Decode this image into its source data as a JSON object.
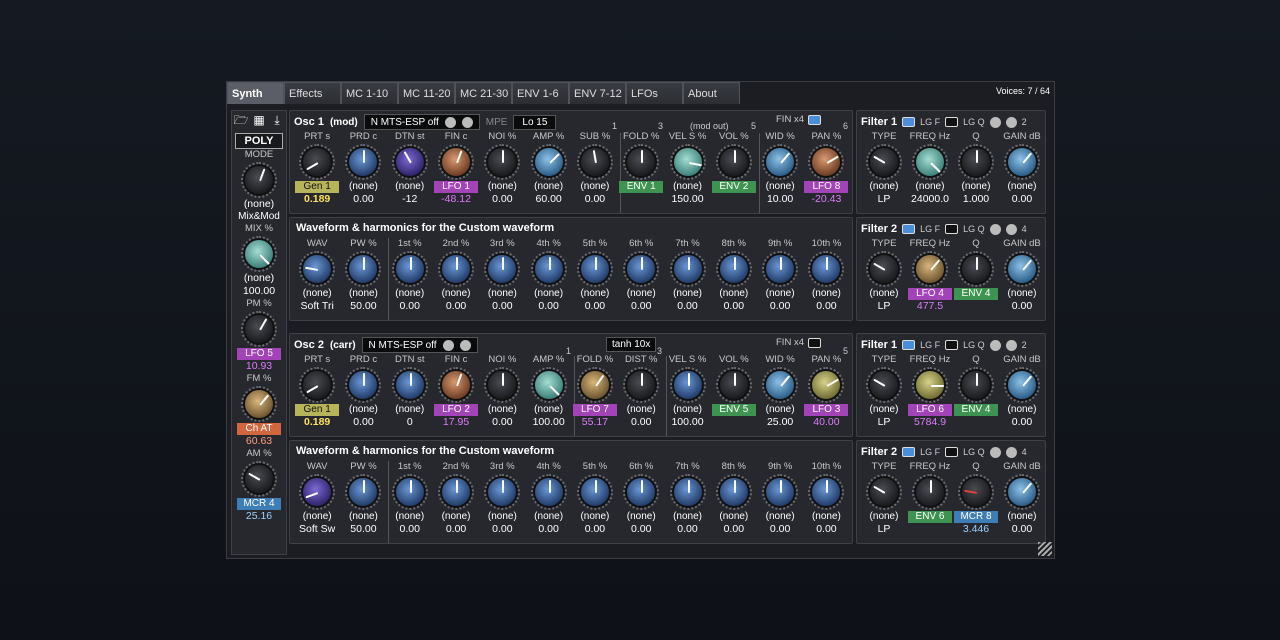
{
  "tabs": [
    "Synth",
    "Effects",
    "MC 1-10",
    "MC 11-20",
    "MC 21-30",
    "ENV 1-6",
    "ENV 7-12",
    "LFOs",
    "About"
  ],
  "voices": "Voices: 7 / 64",
  "left": {
    "poly": "POLY",
    "mode_label": "MODE",
    "mode_mod": "(none)",
    "mixmod": "Mix&Mod",
    "mix_label": "MIX %",
    "mix_mod": "(none)",
    "mix_val": "100.00",
    "pm_label": "PM %",
    "pm_mod": "LFO 5",
    "pm_val": "10.93",
    "fm_label": "FM %",
    "fm_mod": "Ch AT",
    "fm_val": "60.63",
    "am_label": "AM %",
    "am_mod": "MCR 4",
    "am_val": "25.16"
  },
  "osc1": {
    "title": "Osc 1",
    "sub": "(mod)",
    "mts": "N MTS-ESP off",
    "mpe": "MPE",
    "lo": "Lo 15",
    "n1": "1",
    "n3": "3",
    "modout": "(mod out)",
    "n5": "5",
    "n6": "6",
    "fin": "FIN x4",
    "labels": [
      "PRT s",
      "PRD c",
      "DTN st",
      "FIN c",
      "NOI %",
      "AMP %",
      "SUB %",
      "FOLD %",
      "VEL S %",
      "VOL %",
      "WID %",
      "PAN %"
    ],
    "mods": [
      "Gen 1",
      "(none)",
      "(none)",
      "LFO 1",
      "(none)",
      "(none)",
      "(none)",
      "ENV 1",
      "(none)",
      "ENV 2",
      "(none)",
      "LFO 8"
    ],
    "vals": [
      "0.189",
      "0.00",
      "-12",
      "-48.12",
      "0.00",
      "60.00",
      "0.00",
      "",
      "150.00",
      "",
      "10.00",
      "-20.43"
    ]
  },
  "wave1": {
    "title": "Waveform & harmonics for the Custom waveform",
    "labels": [
      "WAV",
      "PW %",
      "1st %",
      "2nd %",
      "3rd %",
      "4th %",
      "5th %",
      "6th %",
      "7th %",
      "8th %",
      "9th %",
      "10th %"
    ],
    "mods": [
      "(none)",
      "(none)",
      "(none)",
      "(none)",
      "(none)",
      "(none)",
      "(none)",
      "(none)",
      "(none)",
      "(none)",
      "(none)",
      "(none)"
    ],
    "vals": [
      "Soft Tri",
      "50.00",
      "0.00",
      "0.00",
      "0.00",
      "0.00",
      "0.00",
      "0.00",
      "0.00",
      "0.00",
      "0.00",
      "0.00"
    ]
  },
  "osc2": {
    "title": "Osc 2",
    "sub": "(carr)",
    "mts": "N MTS-ESP off",
    "tanh": "tanh 10x",
    "n1": "1",
    "n3": "3",
    "n5": "5",
    "fin": "FIN x4",
    "labels": [
      "PRT s",
      "PRD c",
      "DTN st",
      "FIN c",
      "NOI %",
      "AMP %",
      "FOLD %",
      "DIST %",
      "VEL S %",
      "VOL %",
      "WID %",
      "PAN %"
    ],
    "mods": [
      "Gen 1",
      "(none)",
      "(none)",
      "LFO 2",
      "(none)",
      "(none)",
      "LFO 7",
      "(none)",
      "(none)",
      "ENV 5",
      "(none)",
      "LFO 3"
    ],
    "vals": [
      "0.189",
      "0.00",
      "0",
      "17.95",
      "0.00",
      "100.00",
      "55.17",
      "0.00",
      "100.00",
      "",
      "25.00",
      "40.00"
    ]
  },
  "wave2": {
    "title": "Waveform & harmonics for the Custom waveform",
    "labels": [
      "WAV",
      "PW %",
      "1st %",
      "2nd %",
      "3rd %",
      "4th %",
      "5th %",
      "6th %",
      "7th %",
      "8th %",
      "9th %",
      "10th %"
    ],
    "mods": [
      "(none)",
      "(none)",
      "(none)",
      "(none)",
      "(none)",
      "(none)",
      "(none)",
      "(none)",
      "(none)",
      "(none)",
      "(none)",
      "(none)"
    ],
    "vals": [
      "Soft Sw",
      "50.00",
      "0.00",
      "0.00",
      "0.00",
      "0.00",
      "0.00",
      "0.00",
      "0.00",
      "0.00",
      "0.00",
      "0.00"
    ]
  },
  "filters": [
    {
      "title": "Filter 1",
      "lgf": "LG F",
      "lgq": "LG Q",
      "num": "2",
      "labels": [
        "TYPE",
        "FREQ Hz",
        "Q",
        "GAIN dB"
      ],
      "mods": [
        "(none)",
        "(none)",
        "(none)",
        "(none)"
      ],
      "vals": [
        "LP",
        "24000.0",
        "1.000",
        "0.00"
      ]
    },
    {
      "title": "Filter 2",
      "lgf": "LG F",
      "lgq": "LG Q",
      "num": "4",
      "labels": [
        "TYPE",
        "FREQ Hz",
        "Q",
        "GAIN dB"
      ],
      "mods": [
        "(none)",
        "LFO 4",
        "ENV 4",
        "(none)"
      ],
      "vals": [
        "LP",
        "477.5",
        "",
        "0.00"
      ]
    },
    {
      "title": "Filter 1",
      "lgf": "LG F",
      "lgq": "LG Q",
      "num": "2",
      "labels": [
        "TYPE",
        "FREQ Hz",
        "Q",
        "GAIN dB"
      ],
      "mods": [
        "(none)",
        "LFO 6",
        "ENV 4",
        "(none)"
      ],
      "vals": [
        "LP",
        "5784.9",
        "",
        "0.00"
      ]
    },
    {
      "title": "Filter 2",
      "lgf": "LG F",
      "lgq": "LG Q",
      "num": "4",
      "labels": [
        "TYPE",
        "FREQ Hz",
        "Q",
        "GAIN dB"
      ],
      "mods": [
        "(none)",
        "ENV 6",
        "MCR 8",
        "(none)"
      ],
      "vals": [
        "LP",
        "",
        "3.446",
        "0.00"
      ]
    }
  ]
}
